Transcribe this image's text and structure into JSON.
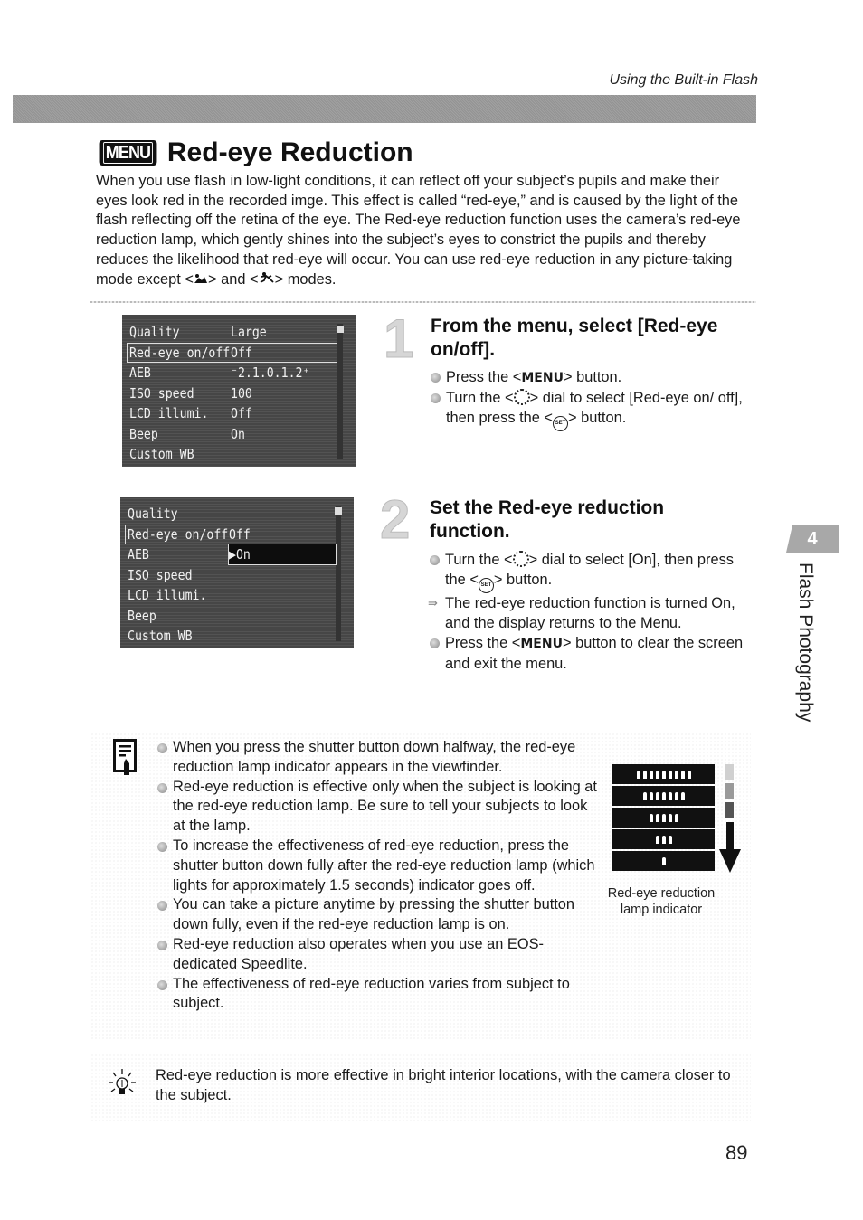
{
  "running_head": "Using the Built-in Flash",
  "header": {
    "menu_badge": "MENU",
    "title": "Red-eye Reduction"
  },
  "intro": {
    "text_before": "When you use flash in low-light conditions, it can reflect off your subject’s pupils and make their eyes look red in the recorded imge. This effect is called “red-eye,” and is caused by the light of the flash reflecting off the retina of the eye. The Red-eye reduction function uses the camera’s red-eye reduction lamp, which gently shines into the subject’s eyes to constrict the pupils and thereby reduces the likelihood that red-eye will occur. You can use red-eye reduction in any picture-taking mode except <",
    "mode1_icon": "landscape-mode-icon",
    "text_middle": "> and <",
    "mode2_icon": "sports-mode-icon",
    "text_after": "> modes."
  },
  "lcd1": {
    "rows": [
      {
        "label": "Quality",
        "value": "Large"
      },
      {
        "label": "Red-eye on/off",
        "value": "Off"
      },
      {
        "label": "AEB",
        "value": "⁻2.1.0.1.2⁺"
      },
      {
        "label": "ISO speed",
        "value": "100"
      },
      {
        "label": "LCD illumi.",
        "value": "Off"
      },
      {
        "label": "Beep",
        "value": "On"
      },
      {
        "label": "Custom WB",
        "value": ""
      }
    ],
    "selected_index": 1
  },
  "lcd2": {
    "rows": [
      {
        "label": "Quality",
        "value": ""
      },
      {
        "label": "Red-eye on/off",
        "value": "Off"
      },
      {
        "label": "AEB",
        "value": ""
      },
      {
        "label": "ISO speed",
        "value": ""
      },
      {
        "label": "LCD illumi.",
        "value": ""
      },
      {
        "label": "Beep",
        "value": ""
      },
      {
        "label": "Custom WB",
        "value": ""
      }
    ],
    "selected_index": 1,
    "popup_option": "▶On"
  },
  "steps": [
    {
      "number": "1",
      "title": "From the menu, select [Red-eye on/off].",
      "items": [
        {
          "type": "bullet",
          "pre": "Press the <",
          "kbd": "MENU",
          "post": "> button."
        },
        {
          "type": "bullet",
          "pre": "Turn the <",
          "icon": "dial",
          "mid": "> dial to select [Red-eye on/ off], then press the <",
          "icon2": "set",
          "post": "> button."
        }
      ]
    },
    {
      "number": "2",
      "title": "Set the Red-eye reduction function.",
      "items": [
        {
          "type": "bullet",
          "pre": "Turn the <",
          "icon": "dial",
          "mid": "> dial to select [On], then press the <",
          "icon2": "set",
          "post": "> button."
        },
        {
          "type": "result",
          "text": "The red-eye reduction function is turned On, and the display returns to the Menu."
        },
        {
          "type": "bullet",
          "pre": "Press the <",
          "kbd": "MENU",
          "post": "> button to clear the screen and exit the menu."
        }
      ]
    }
  ],
  "side_tab": {
    "chapter_number": "4",
    "chapter_title": "Flash Photography"
  },
  "notes": [
    "When you press the shutter button down halfway, the red-eye reduction lamp indicator appears in the viewfinder.",
    "Red-eye reduction is effective only when the subject is looking at the red-eye reduction lamp. Be sure to tell your subjects to look at the lamp.",
    "To increase the effectiveness of red-eye reduction, press the shutter button down fully  after the red-eye reduction lamp (which lights for approximately 1.5 seconds) indicator goes off.",
    "You can take a picture anytime by pressing the shutter button down fully, even if the red-eye reduction lamp is on.",
    "Red-eye reduction also operates when you use an EOS-dedicated Speedlite.",
    "The effectiveness of red-eye reduction varies from subject to subject."
  ],
  "lamp_indicator": {
    "segment_counts": [
      9,
      7,
      5,
      3,
      1
    ],
    "caption": "Red-eye reduction lamp indicator"
  },
  "tip": {
    "text": "Red-eye reduction is more effective in bright interior locations, with the camera closer to the subject."
  },
  "page_number": "89"
}
